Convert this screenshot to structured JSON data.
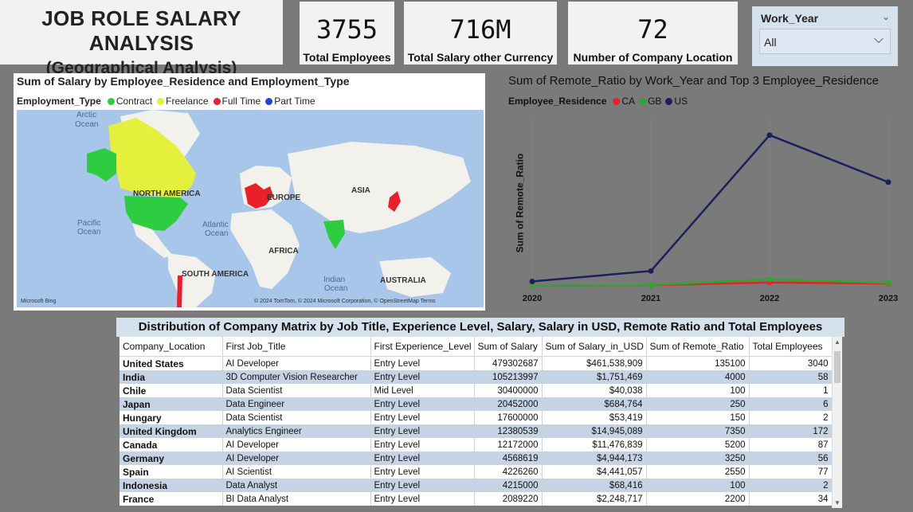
{
  "header": {
    "title_line1": "JOB ROLE SALARY ANALYSIS",
    "title_line2": "(Geographical Analysis)"
  },
  "kpis": [
    {
      "value": "3755",
      "label": "Total Employees"
    },
    {
      "value": "716M",
      "label": "Total Salary other Currency"
    },
    {
      "value": "72",
      "label": "Number of Company Location"
    }
  ],
  "slicer": {
    "label": "Work_Year",
    "value": "All"
  },
  "map": {
    "title": "Sum of Salary by Employee_Residence and Employment_Type",
    "legend_title": "Employment_Type",
    "legend": [
      {
        "name": "Contract",
        "color": "#2ecc40"
      },
      {
        "name": "Freelance",
        "color": "#e5f03c"
      },
      {
        "name": "Full Time",
        "color": "#e8202a"
      },
      {
        "name": "Part Time",
        "color": "#1f46d6"
      }
    ],
    "labels": {
      "arctic": "Arctic",
      "arctic2": "Ocean",
      "north_america": "NORTH AMERICA",
      "europe": "EUROPE",
      "asia": "ASIA",
      "pacific": "Pacific",
      "pacific2": "Ocean",
      "atlantic": "Atlantic",
      "atlantic2": "Ocean",
      "africa": "AFRICA",
      "south_america": "SOUTH AMERICA",
      "indian": "Indian",
      "indian2": "Ocean",
      "australia": "AUSTRALIA",
      "bing": "Microsoft Bing",
      "copyright": "© 2024 TomTom, © 2024 Microsoft Corporation, © OpenStreetMap  Terms"
    },
    "colors": {
      "water": "#a8c6ea",
      "land": "#f3f1ec"
    }
  },
  "chart_data": {
    "type": "line",
    "title": "Sum of Remote_Ratio by Work_Year and Top 3 Employee_Residence",
    "xlabel": "",
    "ylabel": "Sum of Remote_Ratio",
    "legend_title": "Employee_Residence",
    "legend_placement": "top-left",
    "grid": "vertical dotted",
    "x": [
      "2020",
      "2021",
      "2022",
      "2023"
    ],
    "ylim": [
      0,
      80000
    ],
    "series": [
      {
        "name": "CA",
        "color": "#e8202a",
        "values": [
          500,
          700,
          2000,
          1500
        ]
      },
      {
        "name": "GB",
        "color": "#2da82d",
        "values": [
          500,
          800,
          3500,
          1800
        ]
      },
      {
        "name": "US",
        "color": "#1a1f5e",
        "values": [
          2500,
          7500,
          72500,
          50000
        ]
      }
    ]
  },
  "table": {
    "title": "Distribution of Company Matrix by Job Title, Experience Level, Salary, Salary in USD, Remote Ratio and Total Employees",
    "columns": [
      "Company_Location",
      "First Job_Title",
      "First Experience_Level",
      "Sum of Salary",
      "Sum of Salary_in_USD",
      "Sum of Remote_Ratio",
      "Total Employees"
    ],
    "rows": [
      [
        "United States",
        "AI Developer",
        "Entry Level",
        "479302687",
        "$461,538,909",
        "135100",
        "3040"
      ],
      [
        "India",
        "3D Computer Vision Researcher",
        "Entry Level",
        "105213997",
        "$1,751,469",
        "4000",
        "58"
      ],
      [
        "Chile",
        "Data Scientist",
        "Mid Level",
        "30400000",
        "$40,038",
        "100",
        "1"
      ],
      [
        "Japan",
        "Data Engineer",
        "Entry Level",
        "20452000",
        "$684,764",
        "250",
        "6"
      ],
      [
        "Hungary",
        "Data Scientist",
        "Entry Level",
        "17600000",
        "$53,419",
        "150",
        "2"
      ],
      [
        "United Kingdom",
        "Analytics Engineer",
        "Entry Level",
        "12380539",
        "$14,945,089",
        "7350",
        "172"
      ],
      [
        "Canada",
        "AI Developer",
        "Entry Level",
        "12172000",
        "$11,476,839",
        "5200",
        "87"
      ],
      [
        "Germany",
        "AI Developer",
        "Entry Level",
        "4568619",
        "$4,944,173",
        "3250",
        "56"
      ],
      [
        "Spain",
        "AI Scientist",
        "Entry Level",
        "4226260",
        "$4,441,057",
        "2550",
        "77"
      ],
      [
        "Indonesia",
        "Data Analyst",
        "Entry Level",
        "4215000",
        "$68,416",
        "100",
        "2"
      ],
      [
        "France",
        "BI Data Analyst",
        "Entry Level",
        "2089220",
        "$2,248,717",
        "2200",
        "34"
      ]
    ]
  }
}
